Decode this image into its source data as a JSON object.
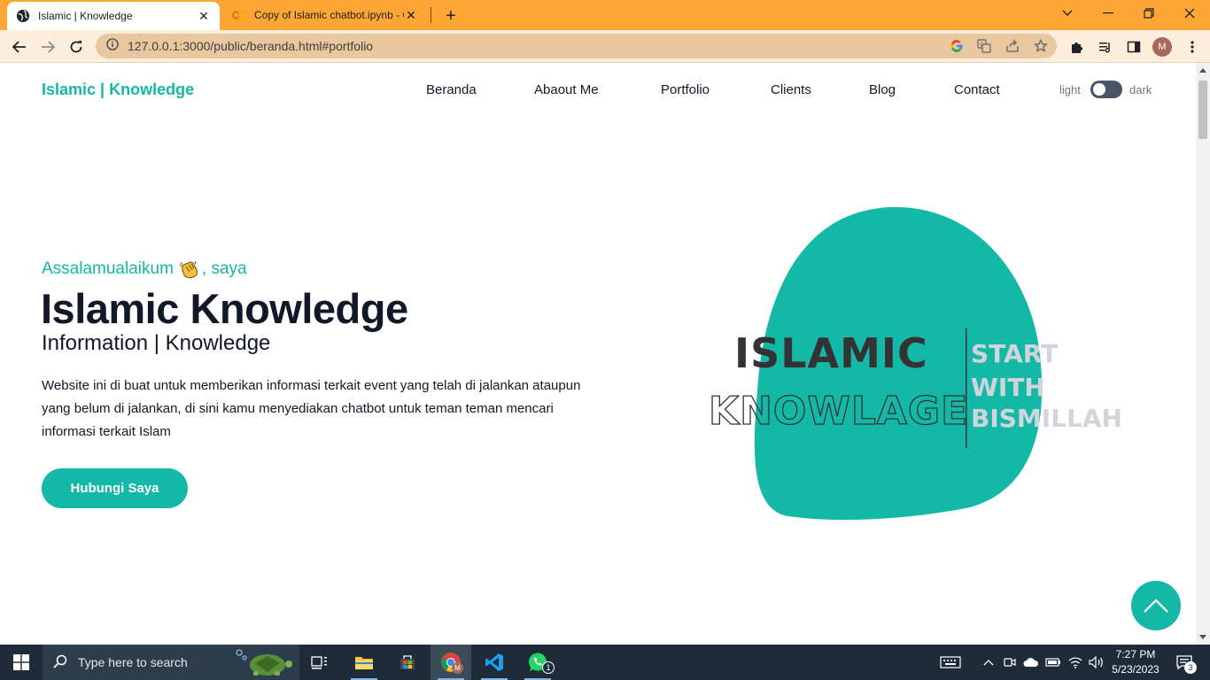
{
  "browser": {
    "tabs": [
      {
        "title": "Islamic | Knowledge",
        "active": true
      },
      {
        "title": "Copy of Islamic chatbot.ipynb - C",
        "active": false
      }
    ],
    "url": "127.0.0.1:3000/public/beranda.html#portfolio",
    "profile_initial": "M",
    "theme_color": "#fda634"
  },
  "site": {
    "brand": "Islamic | Knowledge",
    "nav": [
      "Beranda",
      "Abaout Me",
      "Portfolio",
      "Clients",
      "Blog",
      "Contact"
    ],
    "theme_toggle": {
      "light_label": "light",
      "dark_label": "dark",
      "state": "light"
    },
    "accent_color": "#14b8a6"
  },
  "hero": {
    "greeting_prefix": "Assalamualaikum",
    "greeting_suffix": ", saya",
    "title": "Islamic Knowledge",
    "subtitle": "Information | Knowledge",
    "description": "Website ini di buat untuk memberikan informasi terkait event yang telah di jalankan ataupun yang belum di jalankan, di sini kamu menyediakan chatbot untuk teman teman mencari informasi terkait Islam",
    "cta_label": "Hubungi Saya",
    "art": {
      "word1": "ISLAMIC",
      "word2": "KNOWLAGE",
      "tagline": [
        "START",
        "WITH",
        "BISMILLAH"
      ]
    }
  },
  "taskbar": {
    "search_placeholder": "Type here to search",
    "time": "7:27 PM",
    "date": "5/23/2023",
    "notification_count": "3",
    "whatsapp_badge": "1",
    "chrome_badge": "M"
  }
}
